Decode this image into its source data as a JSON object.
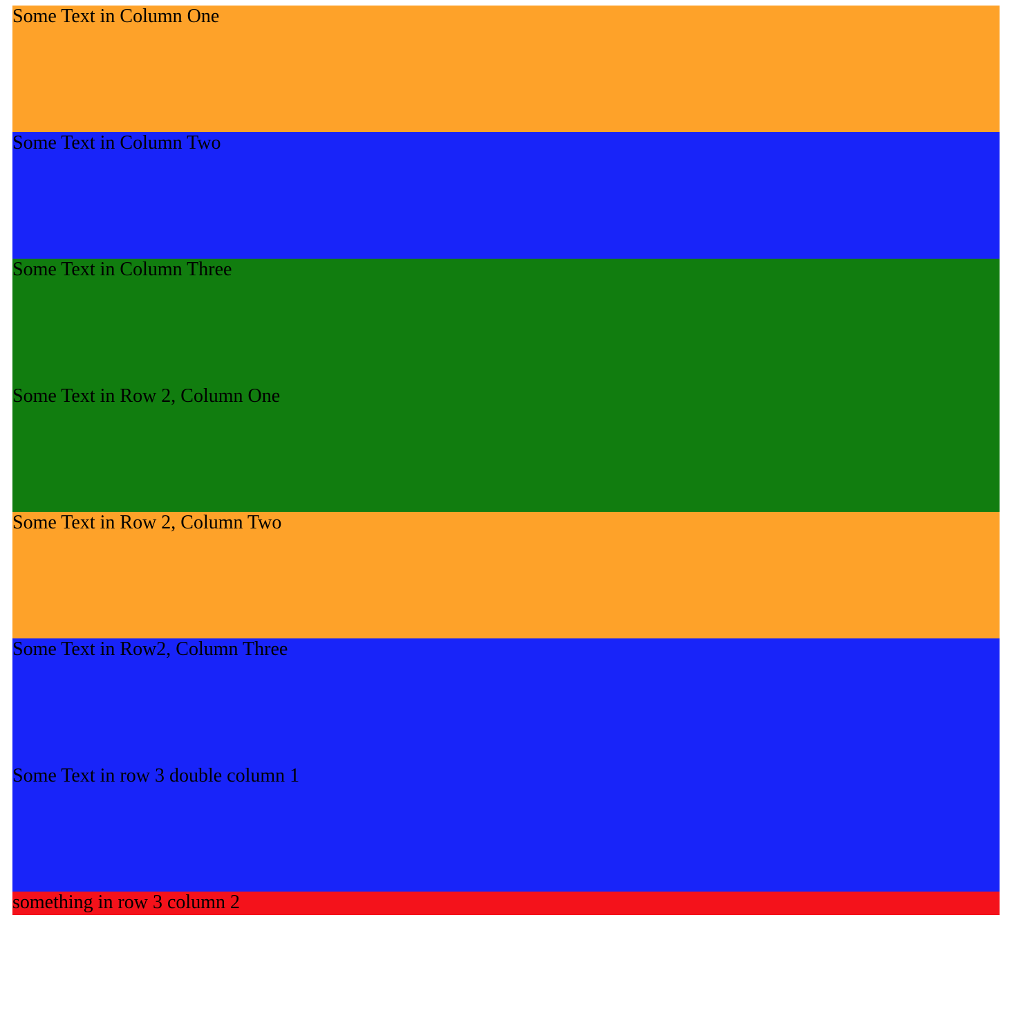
{
  "rows": {
    "r1c1": "Some Text in Column One",
    "r1c2": "Some Text in Column Two",
    "r1c3": "Some Text in Column Three",
    "r2c1": "Some Text in Row 2, Column One",
    "r2c2": "Some Text in Row 2, Column Two",
    "r2c3": "Some Text in Row2, Column Three",
    "r3c1": "Some Text in row 3 double column 1",
    "r3c2": "something in row 3 column 2"
  },
  "colors": {
    "orange": "#fea229",
    "blue": "#1824f9",
    "green": "#117d0f",
    "red": "#f4121b"
  }
}
